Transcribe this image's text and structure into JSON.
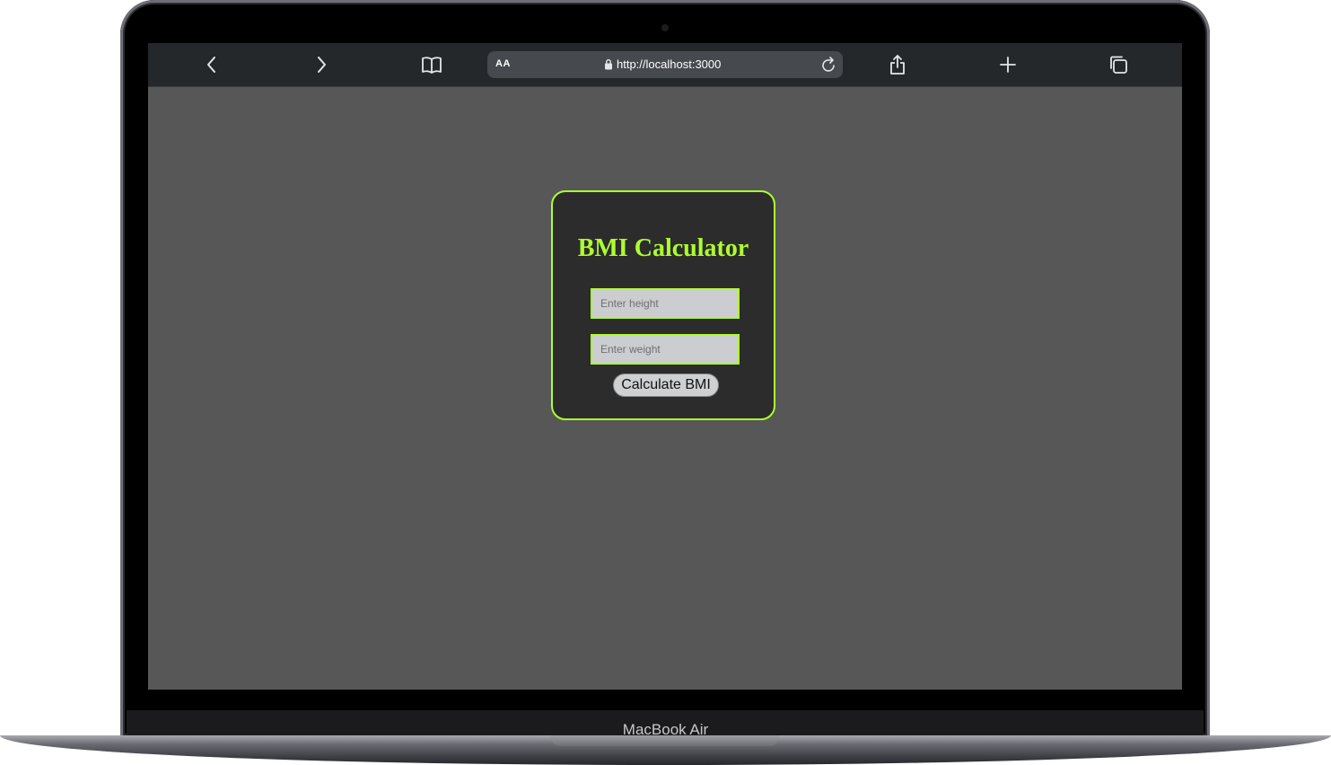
{
  "device": {
    "brand_label": "MacBook Air"
  },
  "browser": {
    "reader_label": "AA",
    "url": "http://localhost:3000",
    "toolbar_icons": [
      "back-icon",
      "forward-icon",
      "bookmarks-icon",
      "lock-icon",
      "reload-icon",
      "share-icon",
      "new-tab-icon",
      "tabs-icon"
    ]
  },
  "bmi": {
    "title": "BMI Calculator",
    "height_placeholder": "Enter height",
    "height_value": "",
    "weight_placeholder": "Enter weight",
    "weight_value": "",
    "calculate_label": "Calculate BMI"
  },
  "colors": {
    "accent": "#adff2f",
    "page_background": "#575757",
    "card_background": "#2c2c2c",
    "toolbar_background": "#25282b"
  }
}
